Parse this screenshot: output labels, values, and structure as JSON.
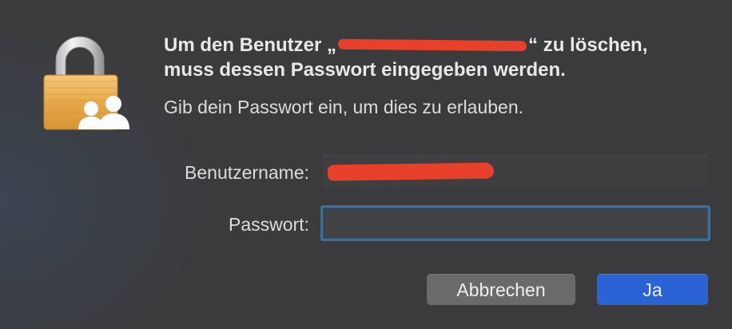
{
  "dialog": {
    "title_prefix": "Um den Benutzer „",
    "title_suffix": "“ zu löschen,",
    "title_line2": "muss dessen Passwort eingegeben werden.",
    "subtitle": "Gib dein Passwort ein, um dies zu erlauben.",
    "icon": "lock-users-icon"
  },
  "form": {
    "username_label": "Benutzername:",
    "password_label": "Passwort:",
    "password_value": ""
  },
  "buttons": {
    "cancel_label": "Abbrechen",
    "ok_label": "Ja"
  },
  "colors": {
    "accent": "#2a63d6",
    "focus_ring": "#3f6e98",
    "redaction": "#e8402a"
  }
}
